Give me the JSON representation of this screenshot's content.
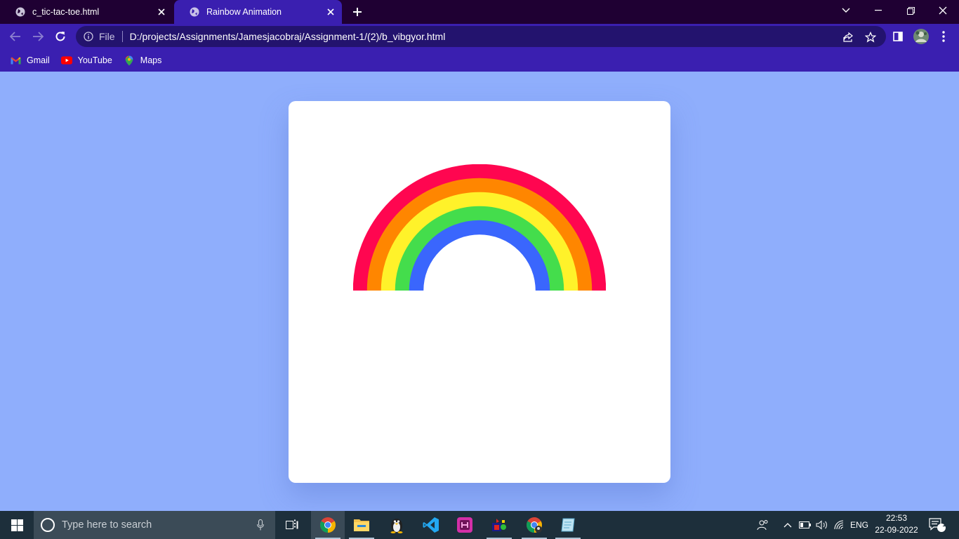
{
  "browser": {
    "tabs": [
      {
        "title": "c_tic-tac-toe.html",
        "active": false,
        "icon": "globe-icon"
      },
      {
        "title": "Rainbow Animation",
        "active": true,
        "icon": "globe-icon"
      }
    ],
    "omnibox": {
      "scheme_label": "File",
      "url": "D:/projects/Assignments/Jamesjacobraj/Assignment-1/(2)/b_vibgyor.html"
    },
    "bookmarks": [
      {
        "label": "Gmail",
        "icon": "gmail-icon"
      },
      {
        "label": "YouTube",
        "icon": "youtube-icon"
      },
      {
        "label": "Maps",
        "icon": "maps-icon"
      }
    ],
    "colors": {
      "frame": "#1f0033",
      "toolbar": "#3a1fb0",
      "omnibox": "#23136e"
    }
  },
  "page": {
    "background": "#8faefc",
    "card_background": "#ffffff",
    "rainbow_bands": [
      {
        "color": "#ff0650"
      },
      {
        "color": "#ff8600"
      },
      {
        "color": "#fff22a"
      },
      {
        "color": "#44dd4c"
      },
      {
        "color": "#3a66fd"
      }
    ]
  },
  "taskbar": {
    "search_placeholder": "Type here to search",
    "apps": [
      "chrome-icon",
      "file-explorer-icon",
      "linux-penguin-icon",
      "vscode-icon",
      "app-icon",
      "game-icon",
      "chrome-profile-icon",
      "notes-icon"
    ],
    "tray": {
      "language": "ENG",
      "time": "22:53",
      "date": "22-09-2022",
      "notification_count": "1"
    }
  }
}
